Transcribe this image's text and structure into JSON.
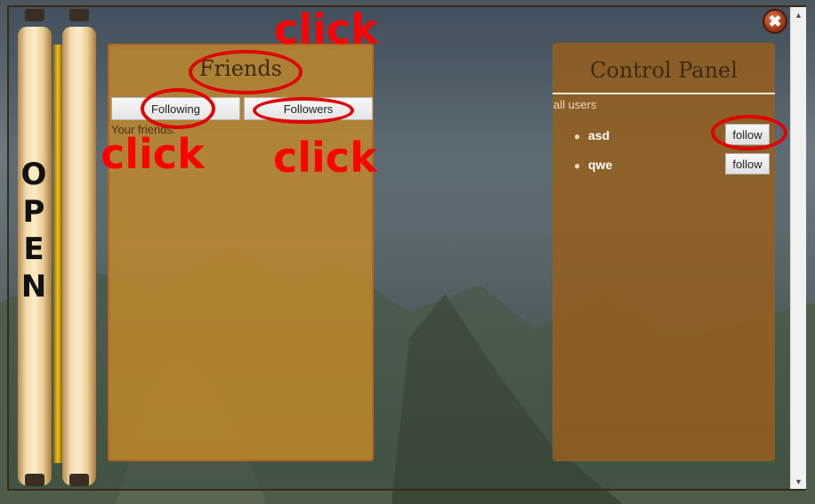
{
  "open_scroll": {
    "letters": [
      "O",
      "P",
      "E",
      "N"
    ]
  },
  "friends": {
    "title": "Friends",
    "tabs": {
      "following": "Following",
      "followers": "Followers"
    },
    "subtitle": "Your friends:"
  },
  "control_panel": {
    "title": "Control Panel",
    "subtitle": "all users",
    "users": [
      {
        "name": "asd",
        "action": "follow"
      },
      {
        "name": "qwe",
        "action": "follow"
      }
    ]
  },
  "annotations": {
    "click_label": "click",
    "color": "#ff0000"
  },
  "icons": {
    "close": "close-icon",
    "scroll_up": "scroll-up-arrow-icon",
    "scroll_down": "scroll-down-arrow-icon"
  }
}
